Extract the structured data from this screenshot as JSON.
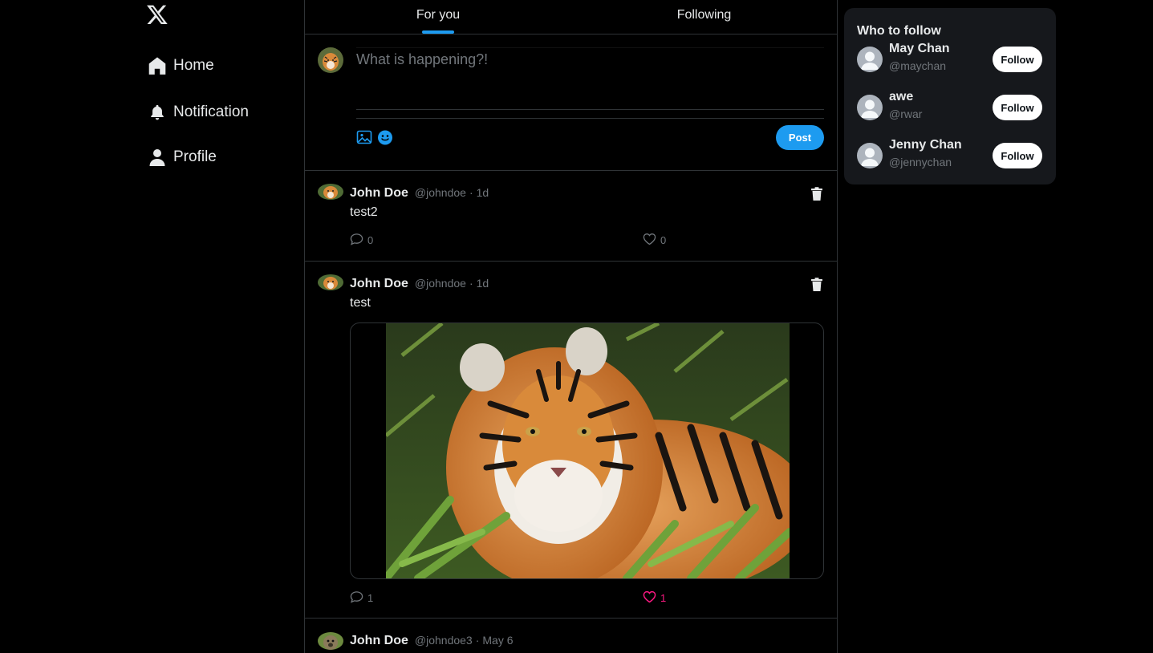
{
  "nav": {
    "logo_icon": "x-logo-icon",
    "items": [
      {
        "label": "Home",
        "icon": "home-icon"
      },
      {
        "label": "Notification",
        "icon": "bell-icon"
      },
      {
        "label": "Profile",
        "icon": "person-icon"
      }
    ]
  },
  "tabs": [
    {
      "label": "For you",
      "active": true
    },
    {
      "label": "Following",
      "active": false
    }
  ],
  "composer": {
    "placeholder": "What is happening?!",
    "post_label": "Post"
  },
  "tweets": [
    {
      "name": "John Doe",
      "handle": "@johndoe",
      "sep": "·",
      "time": "1d",
      "text": "test2",
      "replies": "0",
      "likes": "0",
      "liked": false
    },
    {
      "name": "John Doe",
      "handle": "@johndoe",
      "sep": "·",
      "time": "1d",
      "text": "test",
      "replies": "1",
      "likes": "1",
      "liked": true,
      "has_image": true
    },
    {
      "name": "John Doe",
      "handle": "@johndoe3",
      "sep": "·",
      "time": "May 6",
      "text": ""
    }
  ],
  "who_to_follow": {
    "title": "Who to follow",
    "users": [
      {
        "name": "May Chan",
        "handle": "@maychan",
        "button": "Follow"
      },
      {
        "name": "awe",
        "handle": "@rwar",
        "button": "Follow"
      },
      {
        "name": "Jenny Chan",
        "handle": "@jennychan",
        "button": "Follow"
      }
    ]
  },
  "colors": {
    "accent": "#1d9bf0",
    "like": "#f91880",
    "background": "#000000",
    "muted": "#71767b"
  }
}
